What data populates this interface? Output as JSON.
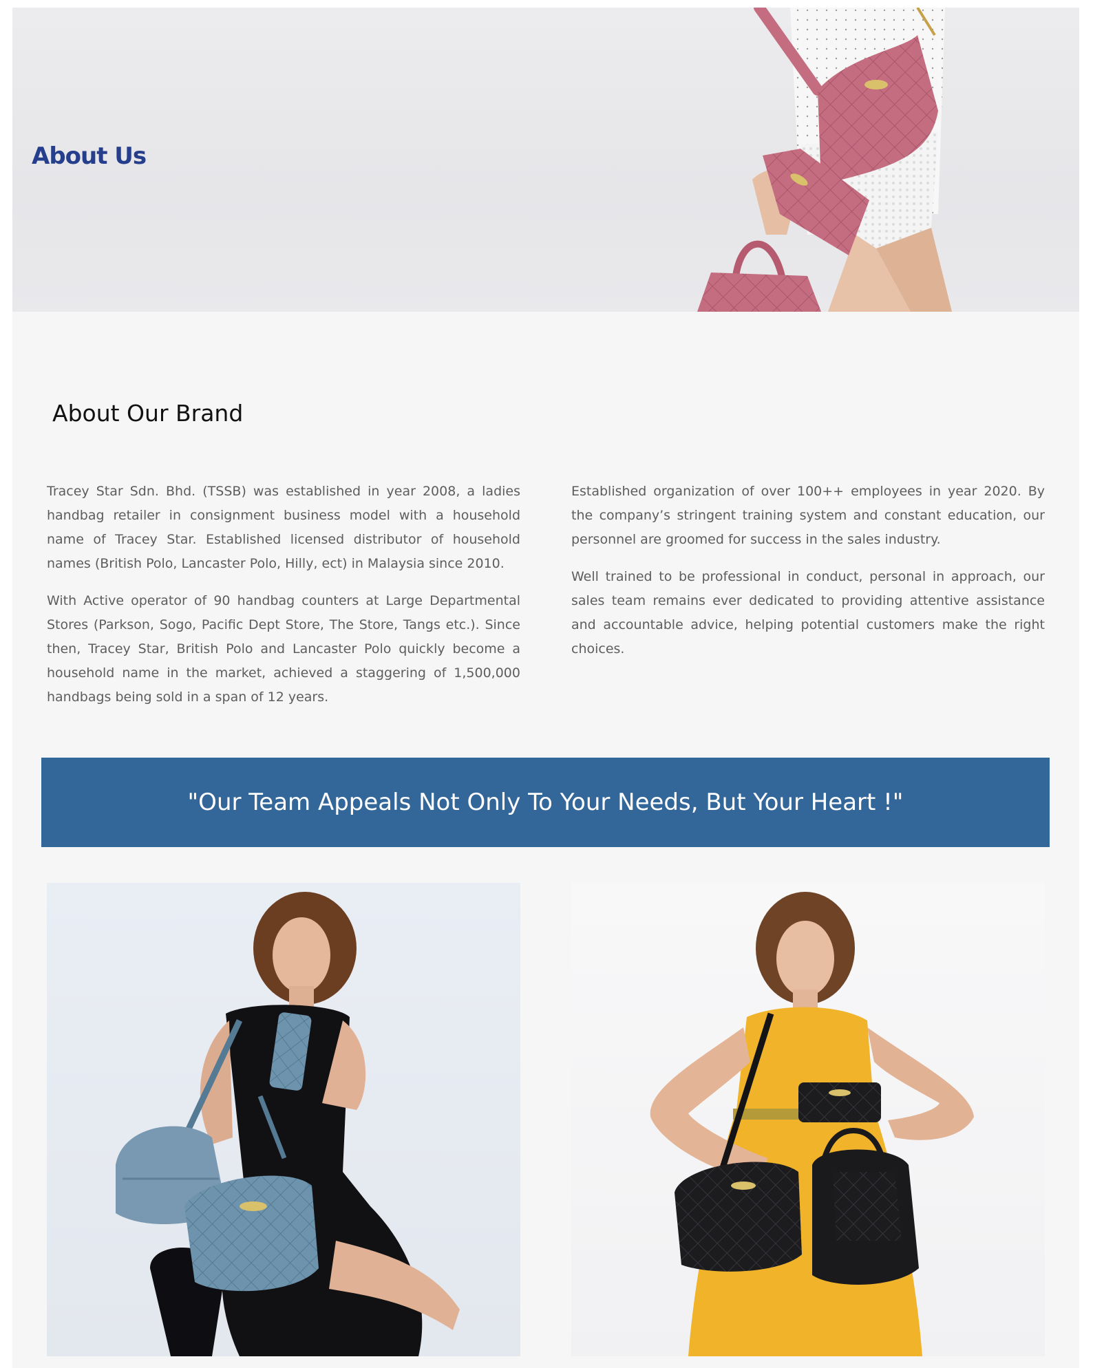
{
  "hero": {
    "title": "About Us",
    "image": "woman-holding-pink-quilted-handbags"
  },
  "brand": {
    "title": "About Our Brand",
    "left_paragraphs": [
      "Tracey Star Sdn. Bhd. (TSSB) was established in year 2008, a ladies handbag retailer in consignment business model with a household name of Tracey Star. Established licensed distributor of household names (British Polo, Lancaster Polo, Hilly, ect) in Malaysia since 2010.",
      "With Active operator of 90 handbag counters at Large Departmental Stores (Parkson, Sogo, Pacific Dept Store, The Store, Tangs etc.). Since then, Tracey Star, British Polo and Lancaster Polo quickly become a household name in the market, achieved a staggering of 1,500,000 handbags being sold in a span of 12 years."
    ],
    "right_paragraphs": [
      "Established organization of over 100++ employees in year 2020. By the company’s stringent training system and constant education, our personnel are groomed for success in the sales industry.",
      "Well trained to be professional in conduct, personal in approach, our sales team remains ever dedicated to providing attentive assistance and accountable advice, helping potential customers make the right choices."
    ]
  },
  "banner": {
    "text": "\"Our Team Appeals Not Only To Your Needs, But Your Heart !\"",
    "color": "#336699"
  },
  "photos": [
    {
      "image": "woman-in-black-dress-with-blue-quilted-handbags"
    },
    {
      "image": "woman-in-yellow-dress-with-black-quilted-handbags"
    }
  ],
  "colors": {
    "heading_blue": "#263f8c",
    "background": "#f6f6f6",
    "handbag_pink": "#c56d80"
  }
}
